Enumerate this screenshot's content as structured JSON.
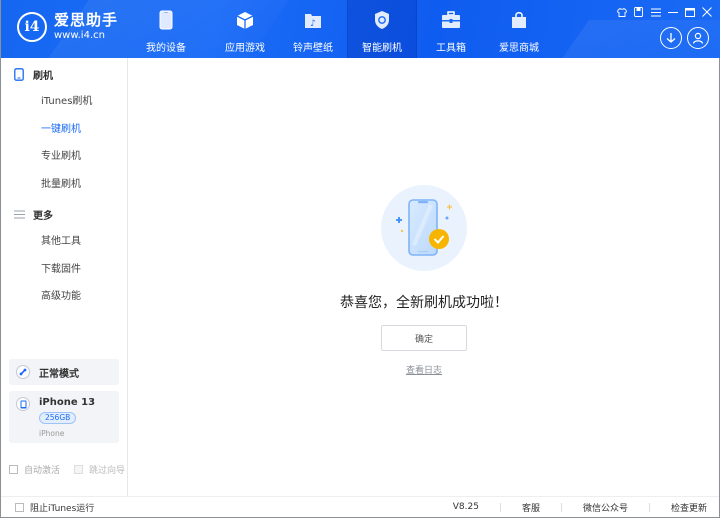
{
  "app": {
    "name": "爱思助手",
    "url": "www.i4.cn",
    "logo_glyph": "i4"
  },
  "nav": {
    "items": [
      {
        "label": "我的设备",
        "icon": "phone-icon"
      },
      {
        "label": "应用游戏",
        "icon": "cube-icon"
      },
      {
        "label": "铃声壁纸",
        "icon": "music-folder-icon"
      },
      {
        "label": "智能刷机",
        "icon": "shield-refresh-icon",
        "active": true
      },
      {
        "label": "工具箱",
        "icon": "toolbox-icon"
      },
      {
        "label": "爱思商城",
        "icon": "shopping-bag-icon"
      }
    ]
  },
  "window_controls": [
    "shirt-icon",
    "note-icon",
    "menu-icon",
    "minimize-icon",
    "maximize-icon",
    "close-icon"
  ],
  "header_actions": [
    "download-icon",
    "user-icon"
  ],
  "sidebar": {
    "sections": [
      {
        "title": "刷机",
        "icon": "tablet-icon",
        "items": [
          {
            "label": "iTunes刷机"
          },
          {
            "label": "一键刷机",
            "active": true
          },
          {
            "label": "专业刷机"
          },
          {
            "label": "批量刷机"
          }
        ]
      },
      {
        "title": "更多",
        "icon": "list-icon",
        "items": [
          {
            "label": "其他工具"
          },
          {
            "label": "下载固件"
          },
          {
            "label": "高级功能"
          }
        ]
      }
    ],
    "mode": {
      "label": "正常模式",
      "icon": "link-icon"
    },
    "device": {
      "name": "iPhone 13",
      "storage": "256GB",
      "type": "iPhone"
    },
    "options": [
      {
        "label": "自动激活",
        "checked": false
      },
      {
        "label": "跳过向导",
        "checked": false,
        "disabled": true
      }
    ]
  },
  "main": {
    "message": "恭喜您，全新刷机成功啦！",
    "confirm_label": "确定",
    "log_link": "查看日志"
  },
  "footer": {
    "block_itunes": {
      "label": "阻止iTunes运行",
      "checked": false
    },
    "version": "V8.25",
    "links": [
      "客服",
      "微信公众号",
      "检查更新"
    ]
  },
  "colors": {
    "brand": "#1a6af5",
    "accent_yellow": "#f7b500"
  }
}
